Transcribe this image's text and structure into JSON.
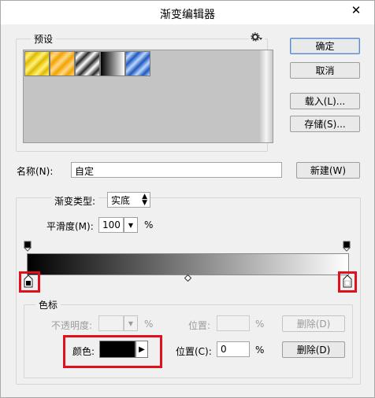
{
  "window": {
    "title": "渐变编辑器",
    "close_label": "✕"
  },
  "presets": {
    "legend": "预设",
    "swatches": [
      {
        "name": "yellow-stripes",
        "colors": [
          "#e6c200",
          "#fff27a",
          "#d9b100"
        ]
      },
      {
        "name": "orange-stripes",
        "colors": [
          "#f5a500",
          "#ffd98a",
          "#f0a000"
        ]
      },
      {
        "name": "black-white-stripes",
        "colors": [
          "#222222",
          "#ffffff",
          "#333333"
        ]
      },
      {
        "name": "black-white",
        "colors": [
          "#000000",
          "#ffffff"
        ]
      },
      {
        "name": "blue-stripes",
        "colors": [
          "#1d5bbf",
          "#bcd6ff",
          "#1e57b8"
        ]
      }
    ]
  },
  "buttons": {
    "ok": "确定",
    "cancel": "取消",
    "load": "载入(L)...",
    "save": "存储(S)...",
    "new": "新建(W)"
  },
  "name_field": {
    "label": "名称(N):",
    "value": "自定"
  },
  "gradient": {
    "type_label": "渐变类型:",
    "type_value": "实底",
    "smoothness_label": "平滑度(M):",
    "smoothness_value": "100",
    "smoothness_unit": "%",
    "start_color": "#000000",
    "end_color": "#ffffff",
    "midpoint": 0.5
  },
  "stops": {
    "legend": "色标",
    "opacity": {
      "label": "不透明度:",
      "unit": "%",
      "position_label": "位置:",
      "position_unit": "%",
      "delete_label": "删除(D)"
    },
    "color": {
      "label": "颜色:",
      "value_color": "#000000",
      "position_label": "位置(C):",
      "position_value": "0",
      "position_unit": "%",
      "delete_label": "删除(D)"
    }
  }
}
